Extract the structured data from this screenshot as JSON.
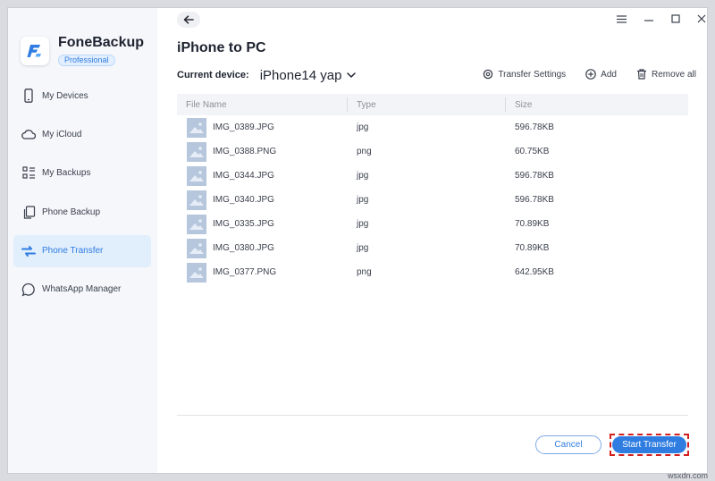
{
  "app": {
    "name": "FoneBackup",
    "edition": "Professional"
  },
  "colors": {
    "accent": "#2f7de1",
    "active_bg": "#e1eefc",
    "highlight_border": "#d21f1f"
  },
  "sidebar": {
    "items": [
      {
        "label": "My Devices",
        "icon": "phone-icon",
        "active": false
      },
      {
        "label": "My iCloud",
        "icon": "cloud-icon",
        "active": false
      },
      {
        "label": "My Backups",
        "icon": "backups-icon",
        "active": false
      },
      {
        "label": "Phone Backup",
        "icon": "phone-backup-icon",
        "active": false
      },
      {
        "label": "Phone Transfer",
        "icon": "transfer-icon",
        "active": true
      },
      {
        "label": "WhatsApp Manager",
        "icon": "whatsapp-icon",
        "active": false
      }
    ]
  },
  "header": {
    "title": "iPhone to PC",
    "device_label": "Current device:",
    "device_name": "iPhone14 yap"
  },
  "toolbar": {
    "transfer_settings": "Transfer Settings",
    "add": "Add",
    "remove_all": "Remove all"
  },
  "table": {
    "headers": {
      "name": "File Name",
      "type": "Type",
      "size": "Size"
    },
    "rows": [
      {
        "name": "IMG_0389.JPG",
        "type": "jpg",
        "size": "596.78KB"
      },
      {
        "name": "IMG_0388.PNG",
        "type": "png",
        "size": "60.75KB"
      },
      {
        "name": "IMG_0344.JPG",
        "type": "jpg",
        "size": "596.78KB"
      },
      {
        "name": "IMG_0340.JPG",
        "type": "jpg",
        "size": "596.78KB"
      },
      {
        "name": "IMG_0335.JPG",
        "type": "jpg",
        "size": "70.89KB"
      },
      {
        "name": "IMG_0380.JPG",
        "type": "jpg",
        "size": "70.89KB"
      },
      {
        "name": "IMG_0377.PNG",
        "type": "png",
        "size": "642.95KB"
      }
    ]
  },
  "footer": {
    "cancel": "Cancel",
    "start": "Start Transfer"
  },
  "watermark": "wsxdn.com"
}
